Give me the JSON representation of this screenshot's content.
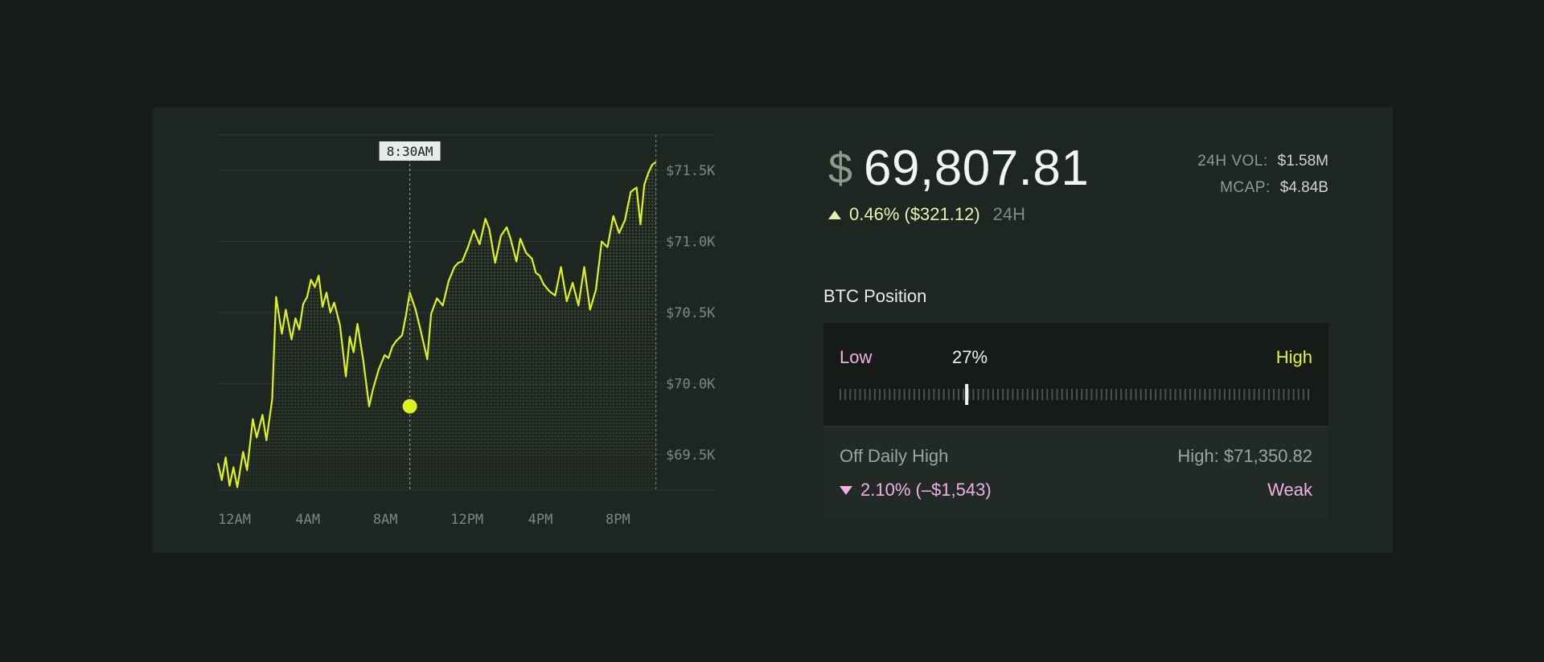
{
  "ticker": {
    "currency_symbol": "$",
    "price": "69,807.81",
    "change": "0.46% ($321.12)",
    "period": "24H"
  },
  "stats": [
    {
      "label": "24H VOL:",
      "value": "$1.58M"
    },
    {
      "label": "MCAP:",
      "value": "$4.84B"
    }
  ],
  "position": {
    "title": "BTC Position",
    "low_label": "Low",
    "high_label": "High",
    "percent": "27%",
    "value": 0.27
  },
  "daily": {
    "label": "Off Daily High",
    "high_text": "High: $71,350.82",
    "change": "2.10% (–$1,543)",
    "strength": "Weak"
  },
  "colors": {
    "accent": "#dff21e",
    "negative": "#f1b0e6",
    "background": "#151c19",
    "card": "#1e2622"
  },
  "chart_data": {
    "type": "area",
    "x_ticks": [
      "12AM",
      "4AM",
      "8AM",
      "12PM",
      "4PM",
      "8PM"
    ],
    "y_ticks": [
      "$71.5K",
      "$71.0K",
      "$70.5K",
      "$70.0K",
      "$69.5K"
    ],
    "y_tick_values": [
      71500,
      71000,
      70500,
      70000,
      69500
    ],
    "ylim": [
      69250,
      71750
    ],
    "xlim": [
      0,
      25.6
    ],
    "marker": {
      "label": "8:30AM",
      "x": 9.9,
      "y": 69840
    },
    "series": [
      {
        "x": [
          0,
          0.2,
          0.4,
          0.6,
          0.8,
          1.0,
          1.3,
          1.5,
          1.8,
          2.0,
          2.3,
          2.5,
          2.8,
          3.0,
          3.3,
          3.5,
          3.8,
          4.0,
          4.2,
          4.4,
          4.6,
          4.8,
          5.0,
          5.2,
          5.4,
          5.6,
          5.8,
          6.0,
          6.3,
          6.6,
          6.8,
          7.0,
          7.2,
          7.5,
          7.8,
          8.0,
          8.3,
          8.6,
          8.8,
          9.0,
          9.2,
          9.5,
          9.7,
          9.9,
          10.2,
          10.5,
          10.8,
          11.0,
          11.3,
          11.6,
          11.9,
          12.2,
          12.4,
          12.6,
          12.9,
          13.2,
          13.5,
          13.8,
          14.0,
          14.3,
          14.6,
          14.9,
          15.1,
          15.4,
          15.6,
          15.9,
          16.2,
          16.4,
          16.6,
          16.8,
          17.1,
          17.4,
          17.7,
          18.0,
          18.3,
          18.6,
          18.9,
          19.2,
          19.5,
          19.8,
          20.1,
          20.4,
          20.7,
          21.0,
          21.3,
          21.6,
          21.8,
          22.0,
          22.2,
          22.4,
          22.6
        ],
        "y": [
          69440,
          69320,
          69480,
          69280,
          69410,
          69270,
          69520,
          69390,
          69750,
          69620,
          69780,
          69600,
          69890,
          70610,
          70350,
          70520,
          70310,
          70460,
          70380,
          70560,
          70610,
          70730,
          70680,
          70760,
          70540,
          70640,
          70500,
          70570,
          70410,
          70050,
          70330,
          70220,
          70420,
          70160,
          69840,
          69960,
          70100,
          70200,
          70180,
          70260,
          70300,
          70340,
          70480,
          70640,
          70520,
          70350,
          70170,
          70490,
          70600,
          70550,
          70720,
          70820,
          70850,
          70860,
          70960,
          71080,
          70980,
          71160,
          71090,
          70850,
          71040,
          71100,
          71020,
          70860,
          71020,
          70920,
          70880,
          70780,
          70760,
          70700,
          70650,
          70620,
          70820,
          70580,
          70710,
          70550,
          70820,
          70520,
          70660,
          71000,
          70960,
          71180,
          71060,
          71150,
          71350,
          71380,
          71120,
          71400,
          71480,
          71540,
          71560
        ],
        "color": "#dff21e"
      }
    ]
  }
}
